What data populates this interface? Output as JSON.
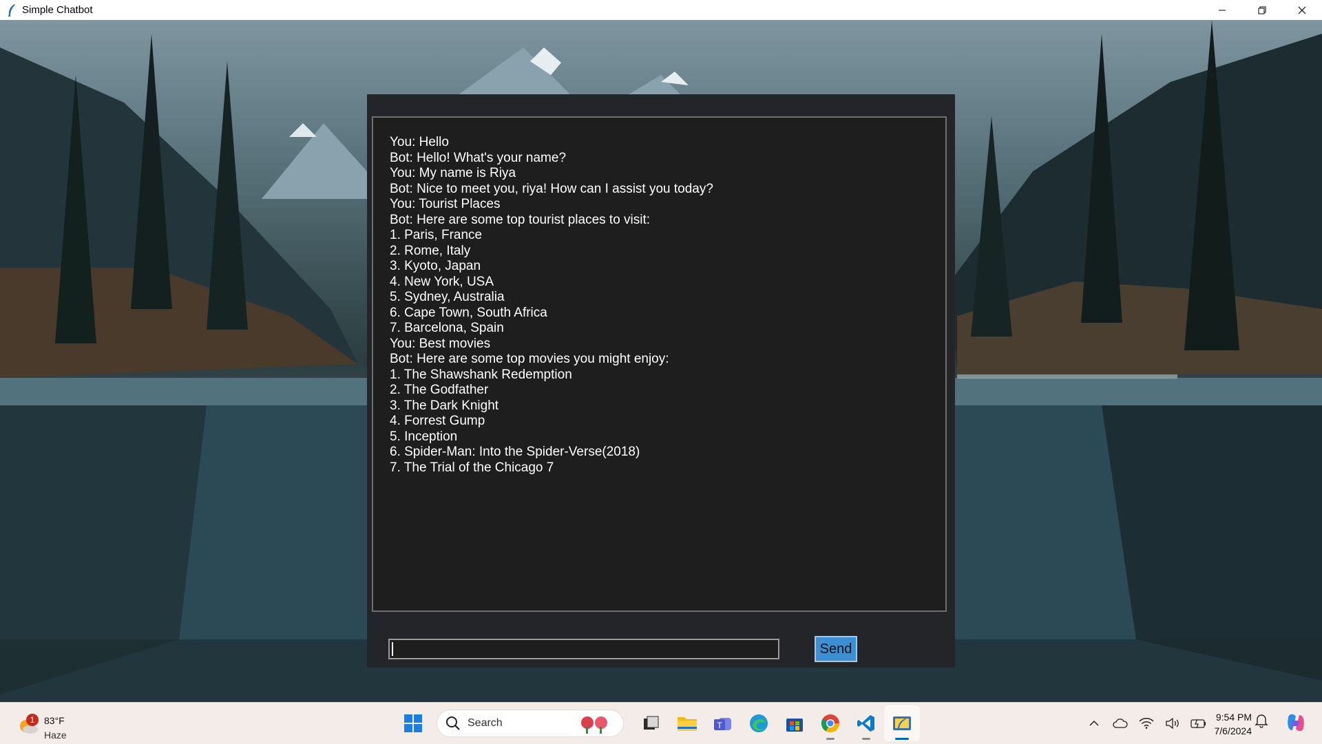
{
  "window": {
    "title": "Simple Chatbot",
    "controls": [
      "minimize",
      "restore",
      "close"
    ]
  },
  "chat": {
    "lines": [
      "You: Hello",
      "Bot: Hello! What's your name?",
      "You: My name is Riya",
      "Bot: Nice to meet you, riya! How can I assist you today?",
      "You: Tourist Places",
      "Bot: Here are some top tourist places to visit:",
      "1. Paris, France",
      "2. Rome, Italy",
      "3. Kyoto, Japan",
      "4. New York, USA",
      "5. Sydney, Australia",
      "6. Cape Town, South Africa",
      "7. Barcelona, Spain",
      "You: Best movies",
      "Bot: Here are some top movies you might enjoy:",
      "1. The Shawshank Redemption",
      "2. The Godfather",
      "3. The Dark Knight",
      "4. Forrest Gump",
      "5. Inception",
      "6. Spider-Man: Into the Spider-Verse(2018)",
      "7. The Trial of the Chicago 7"
    ],
    "input_value": "",
    "send_label": "Send"
  },
  "taskbar": {
    "weather": {
      "badge": "1",
      "temp": "83°F",
      "condition": "Haze"
    },
    "search_label": "Search",
    "apps": [
      "task-view",
      "file-explorer",
      "teams",
      "edge",
      "microsoft-store",
      "chrome",
      "vscode",
      "python"
    ],
    "clock": {
      "time": "9:54 PM",
      "date": "7/6/2024"
    }
  },
  "colors": {
    "chat_bg": "#1e1e1e",
    "send_button": "#3c8fd3",
    "taskbar_bg": "#f3ece9"
  }
}
